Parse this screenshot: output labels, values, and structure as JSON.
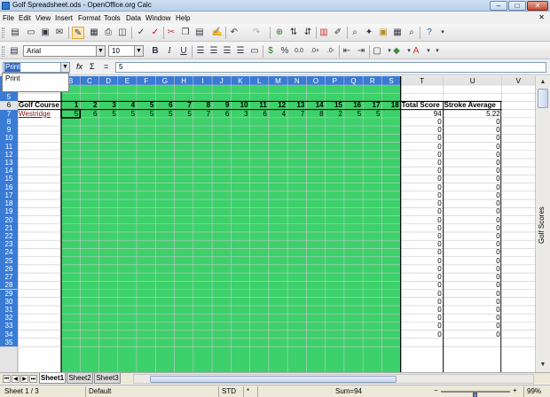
{
  "window": {
    "title": "Golf Spreadsheet.ods - OpenOffice.org Calc",
    "minimize": "–",
    "maximize": "□",
    "close": "✕"
  },
  "menu": [
    "File",
    "Edit",
    "View",
    "Insert",
    "Format",
    "Tools",
    "Data",
    "Window",
    "Help"
  ],
  "menu_close": "✕",
  "formatting": {
    "font": "Arial",
    "size": "10"
  },
  "formula_bar": {
    "name_box": "Print",
    "dropdown_option": "Print",
    "content": "5"
  },
  "sheet": {
    "columns": [
      "B",
      "C",
      "D",
      "E",
      "F",
      "G",
      "H",
      "I",
      "J",
      "K",
      "L",
      "M",
      "N",
      "O",
      "P",
      "Q",
      "R",
      "S",
      "T",
      "U",
      "V"
    ],
    "rows": [
      "4",
      "5",
      "6",
      "7",
      "8",
      "9",
      "10",
      "11",
      "12",
      "13",
      "14",
      "15",
      "16",
      "17",
      "18",
      "19",
      "20",
      "21",
      "22",
      "23",
      "24",
      "25",
      "26",
      "27",
      "28",
      "29",
      "30",
      "31",
      "32",
      "33",
      "34",
      "35"
    ],
    "header_row": {
      "course": "Golf Course",
      "holes": [
        "1",
        "2",
        "3",
        "4",
        "5",
        "6",
        "7",
        "8",
        "9",
        "10",
        "11",
        "12",
        "13",
        "14",
        "15",
        "16",
        "17",
        "18"
      ],
      "total": "Total Score",
      "average": "Stroke Average"
    },
    "data_row": {
      "course": "Westridge",
      "scores": [
        "5",
        "6",
        "5",
        "5",
        "5",
        "5",
        "5",
        "7",
        "6",
        "3",
        "6",
        "4",
        "7",
        "8",
        "2",
        "5",
        "5"
      ],
      "total": "94",
      "average": "5.22"
    },
    "empty_total": "0",
    "empty_average": "0",
    "highlight_color": "#3dd16b",
    "side_label": "Golf Scores"
  },
  "tabs": [
    "Sheet1",
    "Sheet2",
    "Sheet3"
  ],
  "status": {
    "sheet": "Sheet 1 / 3",
    "style": "Default",
    "mode": "STD",
    "modified": "*",
    "sum": "Sum=94",
    "zoom": "99%",
    "zoom_level": 0.5
  }
}
